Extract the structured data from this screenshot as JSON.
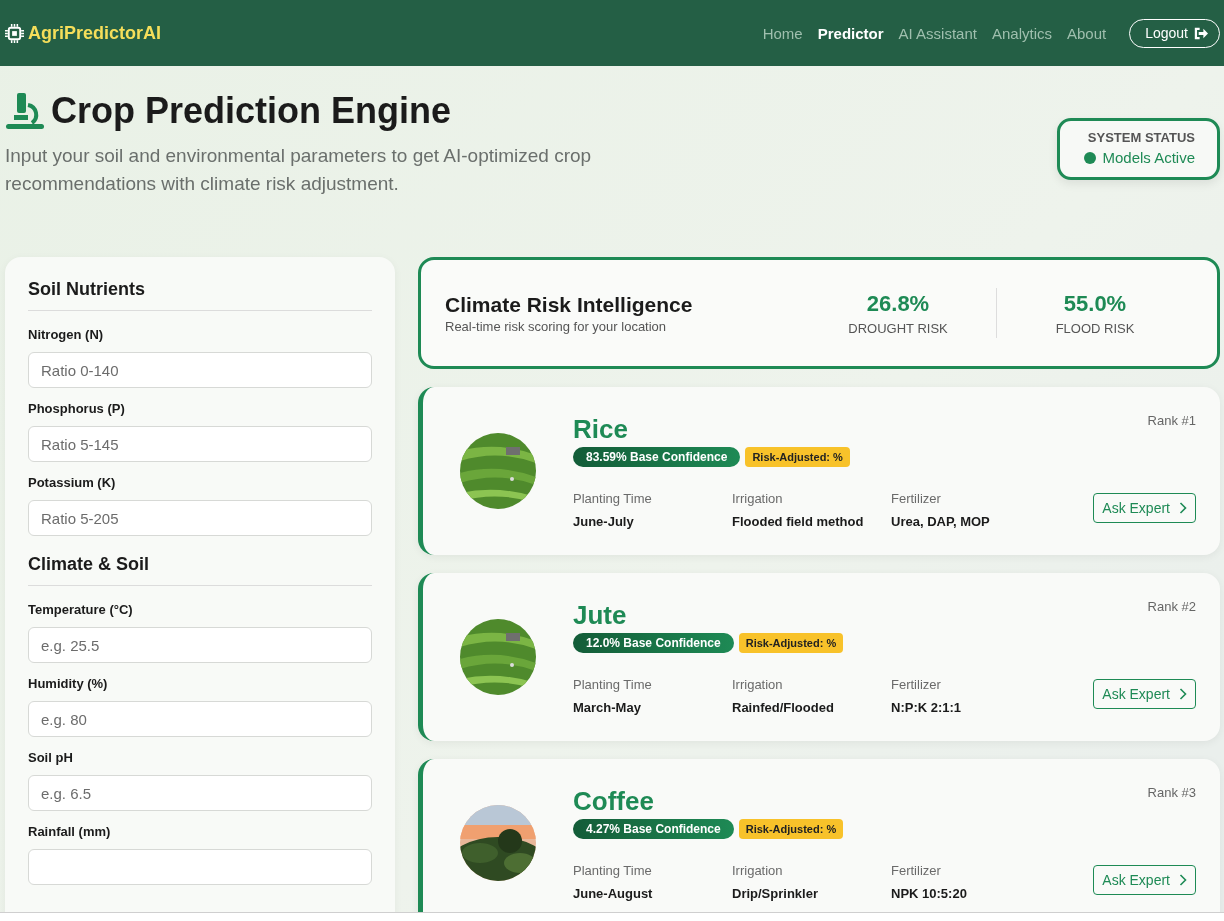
{
  "nav": {
    "brand": "AgriPredictorAI",
    "items": [
      {
        "label": "Home",
        "selected": false
      },
      {
        "label": "Predictor",
        "selected": true
      },
      {
        "label": "AI Assistant",
        "selected": false
      },
      {
        "label": "Analytics",
        "selected": false
      },
      {
        "label": "About",
        "selected": false
      }
    ],
    "logout": "Logout"
  },
  "header": {
    "title": "Crop Prediction Engine",
    "subtitle": "Input your soil and environmental parameters to get AI-optimized crop recommendations with climate risk adjustment.",
    "status": {
      "label": "SYSTEM STATUS",
      "value": "Models Active",
      "color": "#1e8a55"
    }
  },
  "form": {
    "sections": [
      {
        "title": "Soil Nutrients",
        "fields": [
          {
            "label": "Nitrogen (N)",
            "placeholder": "Ratio 0-140"
          },
          {
            "label": "Phosphorus (P)",
            "placeholder": "Ratio 5-145"
          },
          {
            "label": "Potassium (K)",
            "placeholder": "Ratio 5-205"
          }
        ]
      },
      {
        "title": "Climate & Soil",
        "fields": [
          {
            "label": "Temperature (°C)",
            "placeholder": "e.g. 25.5"
          },
          {
            "label": "Humidity (%)",
            "placeholder": "e.g. 80"
          },
          {
            "label": "Soil pH",
            "placeholder": "e.g. 6.5"
          },
          {
            "label": "Rainfall (mm)"
          }
        ]
      }
    ]
  },
  "climate_risk": {
    "title": "Climate Risk Intelligence",
    "subtitle": "Real-time risk scoring for your location",
    "metrics": [
      {
        "value": "26.8%",
        "label": "DROUGHT RISK"
      },
      {
        "value": "55.0%",
        "label": "FLOOD RISK"
      }
    ]
  },
  "crops": [
    {
      "name": "Rice",
      "confidence": "83.59% Base Confidence",
      "risk_adjusted": "Risk-Adjusted: %",
      "rank": "Rank #1",
      "details": [
        {
          "label": "Planting Time",
          "value": "June-July"
        },
        {
          "label": "Irrigation",
          "value": "Flooded field method"
        },
        {
          "label": "Fertilizer",
          "value": "Urea, DAP, MOP"
        }
      ],
      "button": "Ask Expert"
    },
    {
      "name": "Jute",
      "confidence": "12.0% Base Confidence",
      "risk_adjusted": "Risk-Adjusted: %",
      "rank": "Rank #2",
      "details": [
        {
          "label": "Planting Time",
          "value": "March-May"
        },
        {
          "label": "Irrigation",
          "value": "Rainfed/Flooded"
        },
        {
          "label": "Fertilizer",
          "value": "N:P:K 2:1:1"
        }
      ],
      "button": "Ask Expert"
    },
    {
      "name": "Coffee",
      "confidence": "4.27% Base Confidence",
      "risk_adjusted": "Risk-Adjusted: %",
      "rank": "Rank #3",
      "details": [
        {
          "label": "Planting Time",
          "value": "June-August"
        },
        {
          "label": "Irrigation",
          "value": "Drip/Sprinkler"
        },
        {
          "label": "Fertilizer",
          "value": "NPK 10:5:20"
        }
      ],
      "button": "Ask Expert"
    }
  ]
}
